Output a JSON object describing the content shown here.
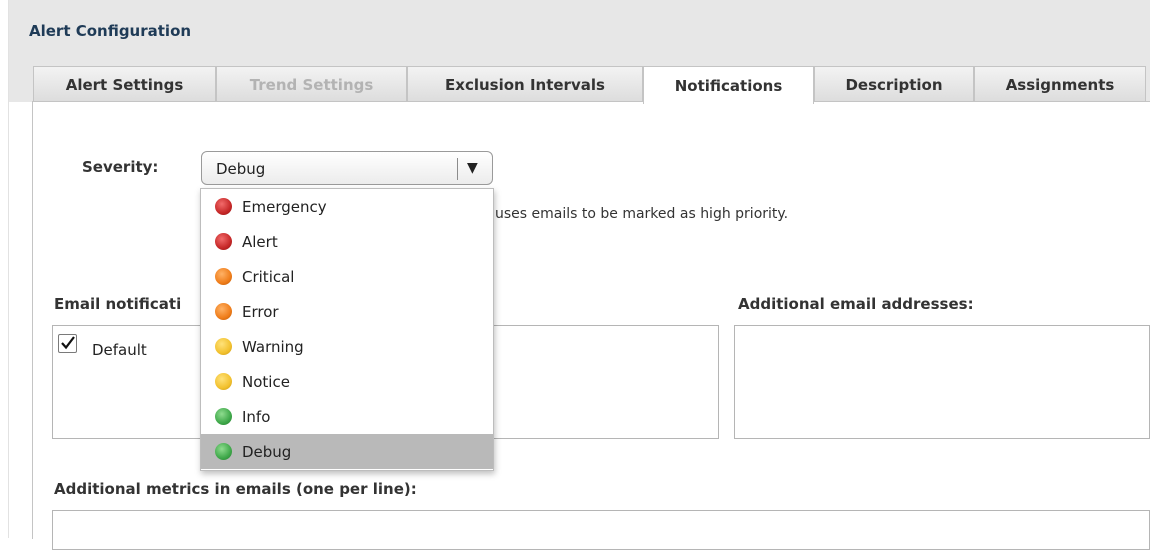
{
  "header": {
    "title": "Alert Configuration"
  },
  "tabs": [
    {
      "label": "Alert Settings",
      "state": "normal"
    },
    {
      "label": "Trend Settings",
      "state": "disabled"
    },
    {
      "label": "Exclusion Intervals",
      "state": "normal"
    },
    {
      "label": "Notifications",
      "state": "active"
    },
    {
      "label": "Description",
      "state": "normal"
    },
    {
      "label": "Assignments",
      "state": "normal"
    }
  ],
  "severity": {
    "label": "Severity:",
    "selected": "Debug",
    "arrow": "▼",
    "hint_partial": "uses emails to be marked as high priority.",
    "options": [
      {
        "label": "Emergency",
        "color": "#c62828"
      },
      {
        "label": "Alert",
        "color": "#c62828"
      },
      {
        "label": "Critical",
        "color": "#ef7d1a"
      },
      {
        "label": "Error",
        "color": "#ef7d1a"
      },
      {
        "label": "Warning",
        "color": "#f2c12e"
      },
      {
        "label": "Notice",
        "color": "#f2c12e"
      },
      {
        "label": "Info",
        "color": "#3fa84a"
      },
      {
        "label": "Debug",
        "color": "#3fa84a"
      }
    ]
  },
  "email_notifications": {
    "label": "Email notificati",
    "items": [
      {
        "label": "Default",
        "checked": true
      }
    ]
  },
  "additional_emails": {
    "label": "Additional email addresses:",
    "value": ""
  },
  "additional_metrics": {
    "label": "Additional metrics in emails (one per line):",
    "value": ""
  }
}
